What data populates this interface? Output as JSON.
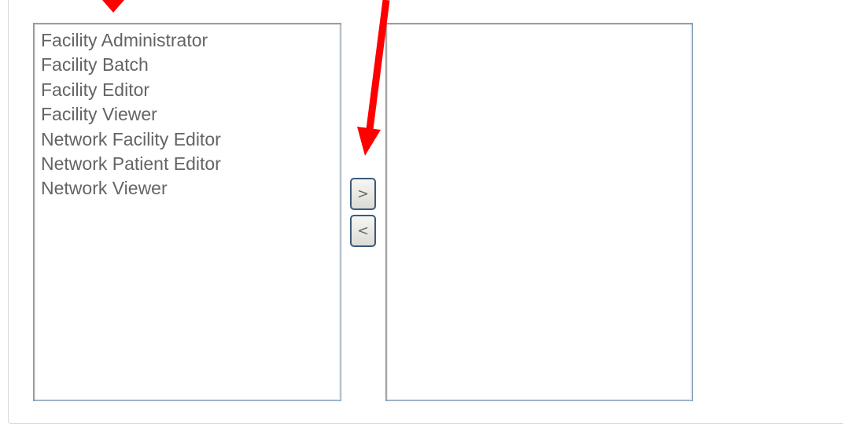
{
  "available_list": {
    "items": [
      "Facility Administrator",
      "Facility Batch",
      "Facility Editor",
      "Facility Viewer",
      "Network Facility Editor",
      "Network Patient Editor",
      "Network Viewer"
    ]
  },
  "selected_list": {
    "items": []
  },
  "buttons": {
    "add_label": ">",
    "remove_label": "<"
  },
  "colors": {
    "annotation_arrow": "#ff0000",
    "list_border": "#7f9db9",
    "button_border": "#3b5a7a",
    "item_text": "#646464"
  }
}
